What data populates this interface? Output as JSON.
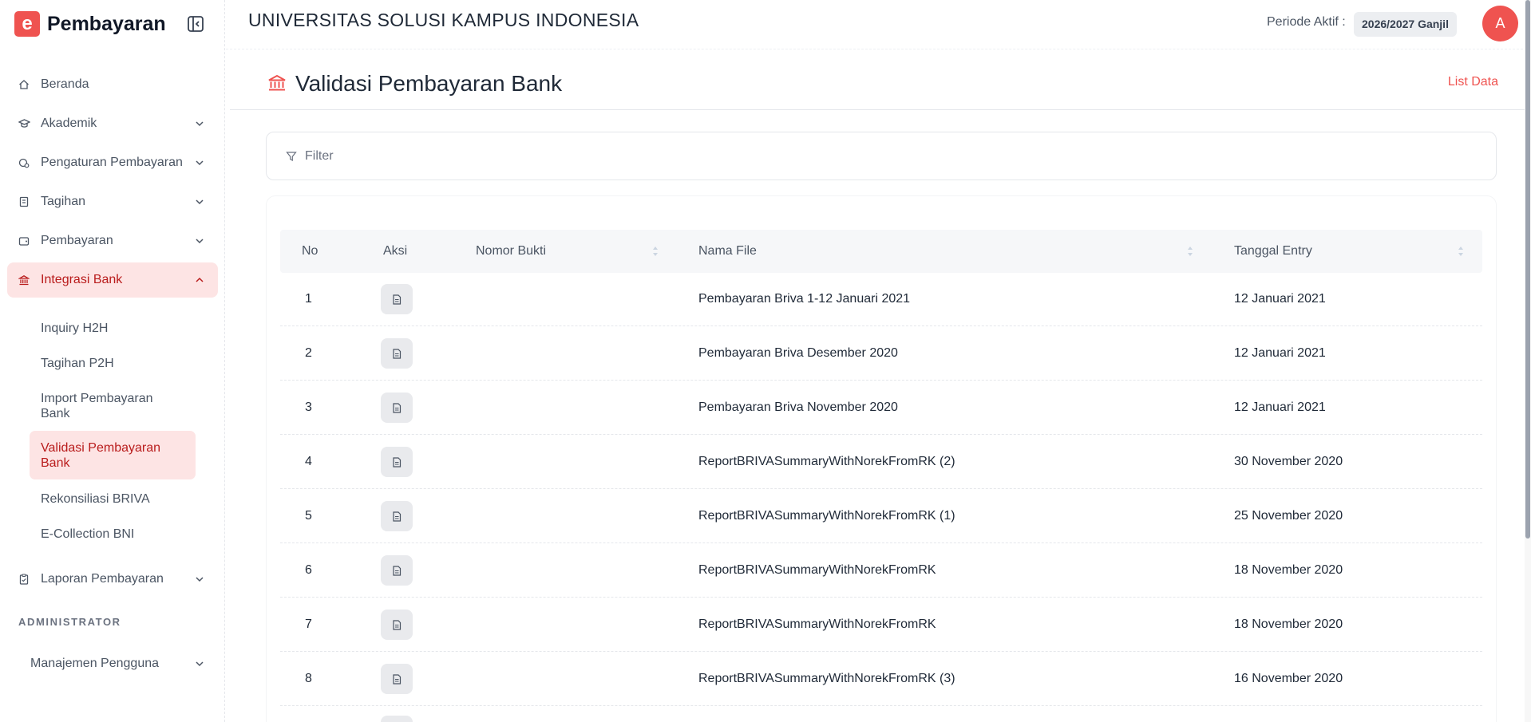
{
  "brand": {
    "logo_letter": "e",
    "name": "Pembayaran"
  },
  "header": {
    "org_title": "UNIVERSITAS SOLUSI KAMPUS INDONESIA",
    "period_label": "Periode Aktif :",
    "period_value": "2026/2027 Ganjil",
    "avatar_letter": "A"
  },
  "sidebar": {
    "items": [
      {
        "label": "Beranda",
        "icon": "home-icon",
        "chevron": false
      },
      {
        "label": "Akademik",
        "icon": "graduation-cap-icon",
        "chevron": "down"
      },
      {
        "label": "Pengaturan Pembayaran",
        "icon": "settings-coin-icon",
        "chevron": "down"
      },
      {
        "label": "Tagihan",
        "icon": "receipt-icon",
        "chevron": "down"
      },
      {
        "label": "Pembayaran",
        "icon": "wallet-icon",
        "chevron": "down"
      },
      {
        "label": "Integrasi Bank",
        "icon": "bank-icon",
        "chevron": "up",
        "active": true
      }
    ],
    "subitems": [
      {
        "label": "Inquiry H2H"
      },
      {
        "label": "Tagihan P2H"
      },
      {
        "label": "Import Pembayaran Bank"
      },
      {
        "label": "Validasi Pembayaran Bank",
        "active": true
      },
      {
        "label": "Rekonsiliasi BRIVA"
      },
      {
        "label": "E-Collection BNI"
      }
    ],
    "report_item": {
      "label": "Laporan Pembayaran",
      "icon": "clipboard-icon"
    },
    "section_label": "ADMINISTRATOR",
    "admin_item": {
      "label": "Manajemen Pengguna"
    }
  },
  "page": {
    "title": "Validasi Pembayaran Bank",
    "title_icon": "bank-icon",
    "list_link": "List Data",
    "filter_label": "Filter"
  },
  "table": {
    "columns": [
      "No",
      "Aksi",
      "Nomor Bukti",
      "Nama File",
      "Tanggal Entry"
    ],
    "rows": [
      {
        "no": "1",
        "nomor_bukti": "",
        "nama_file": "Pembayaran Briva 1-12 Januari 2021",
        "tanggal": "12 Januari 2021"
      },
      {
        "no": "2",
        "nomor_bukti": "",
        "nama_file": "Pembayaran Briva Desember 2020",
        "tanggal": "12 Januari 2021"
      },
      {
        "no": "3",
        "nomor_bukti": "",
        "nama_file": "Pembayaran Briva November 2020",
        "tanggal": "12 Januari 2021"
      },
      {
        "no": "4",
        "nomor_bukti": "",
        "nama_file": "ReportBRIVASummaryWithNorekFromRK (2)",
        "tanggal": "30 November 2020"
      },
      {
        "no": "5",
        "nomor_bukti": "",
        "nama_file": "ReportBRIVASummaryWithNorekFromRK (1)",
        "tanggal": "25 November 2020"
      },
      {
        "no": "6",
        "nomor_bukti": "",
        "nama_file": "ReportBRIVASummaryWithNorekFromRK",
        "tanggal": "18 November 2020"
      },
      {
        "no": "7",
        "nomor_bukti": "",
        "nama_file": "ReportBRIVASummaryWithNorekFromRK",
        "tanggal": "18 November 2020"
      },
      {
        "no": "8",
        "nomor_bukti": "",
        "nama_file": "ReportBRIVASummaryWithNorekFromRK (3)",
        "tanggal": "16 November 2020"
      }
    ]
  },
  "colors": {
    "accent": "#ef5350",
    "active_bg": "#fde4e4",
    "active_text": "#b91c1c"
  }
}
